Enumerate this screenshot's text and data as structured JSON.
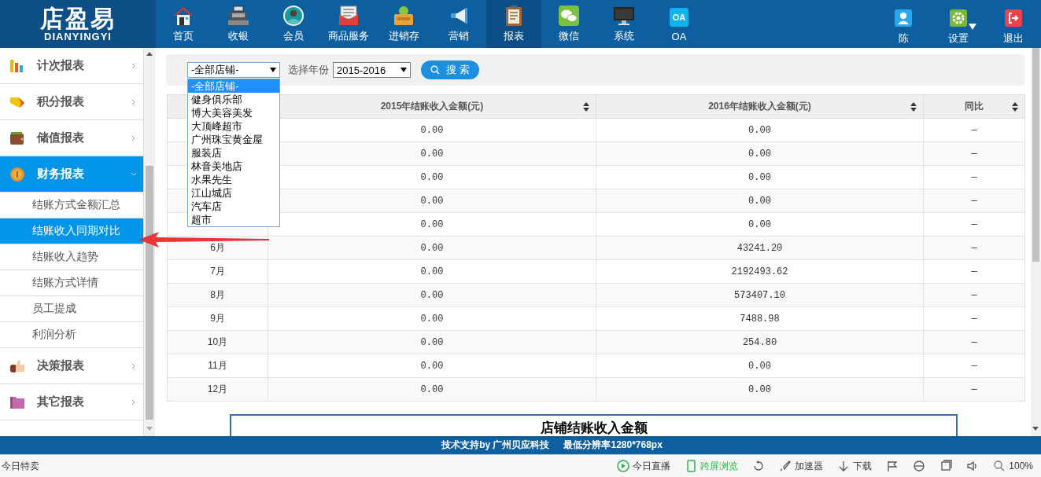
{
  "header": {
    "logo": {
      "title": "店盈易",
      "subtitle": "DIANYINGYI"
    },
    "nav": [
      {
        "label": "首页",
        "selected": false
      },
      {
        "label": "收银",
        "selected": false
      },
      {
        "label": "会员",
        "selected": false
      },
      {
        "label": "商品服务",
        "selected": false
      },
      {
        "label": "进销存",
        "selected": false
      },
      {
        "label": "营销",
        "selected": false
      },
      {
        "label": "报表",
        "selected": true
      },
      {
        "label": "微信",
        "selected": false
      },
      {
        "label": "系统",
        "selected": false
      },
      {
        "label": "OA",
        "selected": false,
        "icon_text": "OA"
      }
    ],
    "user_menu": [
      {
        "label": "陈",
        "has_menu": false
      },
      {
        "label": "设置",
        "has_menu": true
      },
      {
        "label": "退出",
        "has_menu": false
      }
    ]
  },
  "sidebar": {
    "items": [
      {
        "label": "计次报表",
        "selected": false,
        "expanded": false
      },
      {
        "label": "积分报表",
        "selected": false,
        "expanded": false
      },
      {
        "label": "储值报表",
        "selected": false,
        "expanded": false
      },
      {
        "label": "财务报表",
        "selected": true,
        "expanded": true,
        "children": [
          {
            "label": "结账方式金额汇总",
            "selected": false
          },
          {
            "label": "结账收入同期对比",
            "selected": true
          },
          {
            "label": "结账收入趋势",
            "selected": false
          },
          {
            "label": "结账方式详情",
            "selected": false
          },
          {
            "label": "员工提成",
            "selected": false
          },
          {
            "label": "利润分析",
            "selected": false
          }
        ]
      },
      {
        "label": "决策报表",
        "selected": false,
        "expanded": false
      },
      {
        "label": "其它报表",
        "selected": false,
        "expanded": false
      }
    ]
  },
  "filter": {
    "store_select": {
      "value": "-全部店铺-",
      "open": true,
      "options": [
        {
          "label": "-全部店铺-",
          "selected": true
        },
        {
          "label": "健身俱乐部",
          "selected": false
        },
        {
          "label": "博大美容美发",
          "selected": false
        },
        {
          "label": "大顶峰超市",
          "selected": false
        },
        {
          "label": "广州珠宝黄金屋",
          "selected": false
        },
        {
          "label": "服装店",
          "selected": false
        },
        {
          "label": "林音美地店",
          "selected": false
        },
        {
          "label": "水果先生",
          "selected": false
        },
        {
          "label": "江山城店",
          "selected": false
        },
        {
          "label": "汽车店",
          "selected": false
        },
        {
          "label": "超市",
          "selected": false
        }
      ]
    },
    "year_label": "选择年份",
    "year_select": {
      "value": "2015-2016"
    },
    "search_button": "搜 索"
  },
  "table": {
    "columns": [
      "2015年结账收入金额(元)",
      "2016年结账收入金额(元)",
      "同比"
    ],
    "rows": [
      {
        "income_2015": "0.00",
        "income_2016": "0.00",
        "yoy": "—"
      },
      {
        "income_2015": "0.00",
        "income_2016": "0.00",
        "yoy": "—"
      },
      {
        "income_2015": "0.00",
        "income_2016": "0.00",
        "yoy": "—"
      },
      {
        "income_2015": "0.00",
        "income_2016": "0.00",
        "yoy": "—"
      },
      {
        "income_2015": "0.00",
        "income_2016": "0.00",
        "yoy": "—"
      },
      {
        "month": "6月",
        "income_2015": "0.00",
        "income_2016": "43241.20",
        "yoy": "—"
      },
      {
        "month": "7月",
        "income_2015": "0.00",
        "income_2016": "2192493.62",
        "yoy": "—"
      },
      {
        "month": "8月",
        "income_2015": "0.00",
        "income_2016": "573407.10",
        "yoy": "—"
      },
      {
        "month": "9月",
        "income_2015": "0.00",
        "income_2016": "7488.98",
        "yoy": "—"
      },
      {
        "month": "10月",
        "income_2015": "0.00",
        "income_2016": "254.80",
        "yoy": "—"
      },
      {
        "month": "11月",
        "income_2015": "0.00",
        "income_2016": "0.00",
        "yoy": "—"
      },
      {
        "month": "12月",
        "income_2015": "0.00",
        "income_2016": "0.00",
        "yoy": "—"
      }
    ]
  },
  "chart_title": "店铺结账收入金额",
  "footer": [
    "技术支持by 广州贝应科技",
    "最低分辨率1280*768px"
  ],
  "status_bar": {
    "left": "今日特卖",
    "items": [
      {
        "label": "今日直播",
        "active": false
      },
      {
        "label": "跨屏浏览",
        "active": true
      },
      {
        "label": "加速器",
        "active": false
      },
      {
        "label": "下载",
        "active": false
      },
      {
        "label": "100%",
        "active": false
      }
    ]
  }
}
